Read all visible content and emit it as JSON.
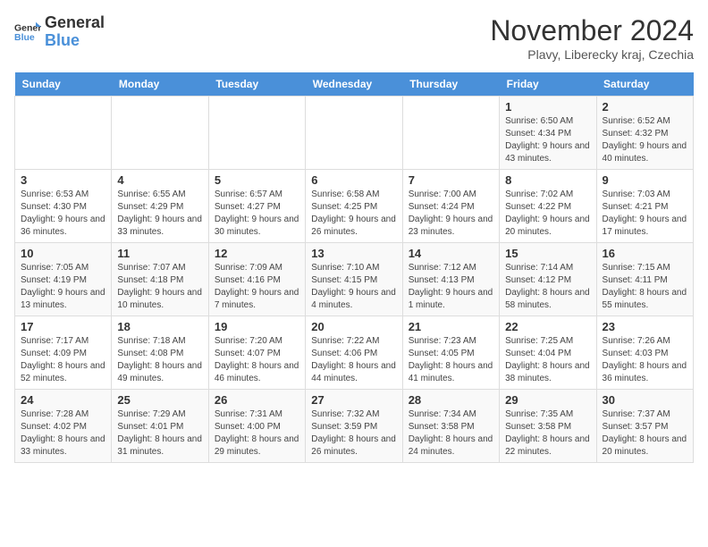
{
  "header": {
    "logo_line1": "General",
    "logo_line2": "Blue",
    "month_title": "November 2024",
    "location": "Plavy, Liberecky kraj, Czechia"
  },
  "weekdays": [
    "Sunday",
    "Monday",
    "Tuesday",
    "Wednesday",
    "Thursday",
    "Friday",
    "Saturday"
  ],
  "weeks": [
    [
      {
        "day": "",
        "info": ""
      },
      {
        "day": "",
        "info": ""
      },
      {
        "day": "",
        "info": ""
      },
      {
        "day": "",
        "info": ""
      },
      {
        "day": "",
        "info": ""
      },
      {
        "day": "1",
        "info": "Sunrise: 6:50 AM\nSunset: 4:34 PM\nDaylight: 9 hours and 43 minutes."
      },
      {
        "day": "2",
        "info": "Sunrise: 6:52 AM\nSunset: 4:32 PM\nDaylight: 9 hours and 40 minutes."
      }
    ],
    [
      {
        "day": "3",
        "info": "Sunrise: 6:53 AM\nSunset: 4:30 PM\nDaylight: 9 hours and 36 minutes."
      },
      {
        "day": "4",
        "info": "Sunrise: 6:55 AM\nSunset: 4:29 PM\nDaylight: 9 hours and 33 minutes."
      },
      {
        "day": "5",
        "info": "Sunrise: 6:57 AM\nSunset: 4:27 PM\nDaylight: 9 hours and 30 minutes."
      },
      {
        "day": "6",
        "info": "Sunrise: 6:58 AM\nSunset: 4:25 PM\nDaylight: 9 hours and 26 minutes."
      },
      {
        "day": "7",
        "info": "Sunrise: 7:00 AM\nSunset: 4:24 PM\nDaylight: 9 hours and 23 minutes."
      },
      {
        "day": "8",
        "info": "Sunrise: 7:02 AM\nSunset: 4:22 PM\nDaylight: 9 hours and 20 minutes."
      },
      {
        "day": "9",
        "info": "Sunrise: 7:03 AM\nSunset: 4:21 PM\nDaylight: 9 hours and 17 minutes."
      }
    ],
    [
      {
        "day": "10",
        "info": "Sunrise: 7:05 AM\nSunset: 4:19 PM\nDaylight: 9 hours and 13 minutes."
      },
      {
        "day": "11",
        "info": "Sunrise: 7:07 AM\nSunset: 4:18 PM\nDaylight: 9 hours and 10 minutes."
      },
      {
        "day": "12",
        "info": "Sunrise: 7:09 AM\nSunset: 4:16 PM\nDaylight: 9 hours and 7 minutes."
      },
      {
        "day": "13",
        "info": "Sunrise: 7:10 AM\nSunset: 4:15 PM\nDaylight: 9 hours and 4 minutes."
      },
      {
        "day": "14",
        "info": "Sunrise: 7:12 AM\nSunset: 4:13 PM\nDaylight: 9 hours and 1 minute."
      },
      {
        "day": "15",
        "info": "Sunrise: 7:14 AM\nSunset: 4:12 PM\nDaylight: 8 hours and 58 minutes."
      },
      {
        "day": "16",
        "info": "Sunrise: 7:15 AM\nSunset: 4:11 PM\nDaylight: 8 hours and 55 minutes."
      }
    ],
    [
      {
        "day": "17",
        "info": "Sunrise: 7:17 AM\nSunset: 4:09 PM\nDaylight: 8 hours and 52 minutes."
      },
      {
        "day": "18",
        "info": "Sunrise: 7:18 AM\nSunset: 4:08 PM\nDaylight: 8 hours and 49 minutes."
      },
      {
        "day": "19",
        "info": "Sunrise: 7:20 AM\nSunset: 4:07 PM\nDaylight: 8 hours and 46 minutes."
      },
      {
        "day": "20",
        "info": "Sunrise: 7:22 AM\nSunset: 4:06 PM\nDaylight: 8 hours and 44 minutes."
      },
      {
        "day": "21",
        "info": "Sunrise: 7:23 AM\nSunset: 4:05 PM\nDaylight: 8 hours and 41 minutes."
      },
      {
        "day": "22",
        "info": "Sunrise: 7:25 AM\nSunset: 4:04 PM\nDaylight: 8 hours and 38 minutes."
      },
      {
        "day": "23",
        "info": "Sunrise: 7:26 AM\nSunset: 4:03 PM\nDaylight: 8 hours and 36 minutes."
      }
    ],
    [
      {
        "day": "24",
        "info": "Sunrise: 7:28 AM\nSunset: 4:02 PM\nDaylight: 8 hours and 33 minutes."
      },
      {
        "day": "25",
        "info": "Sunrise: 7:29 AM\nSunset: 4:01 PM\nDaylight: 8 hours and 31 minutes."
      },
      {
        "day": "26",
        "info": "Sunrise: 7:31 AM\nSunset: 4:00 PM\nDaylight: 8 hours and 29 minutes."
      },
      {
        "day": "27",
        "info": "Sunrise: 7:32 AM\nSunset: 3:59 PM\nDaylight: 8 hours and 26 minutes."
      },
      {
        "day": "28",
        "info": "Sunrise: 7:34 AM\nSunset: 3:58 PM\nDaylight: 8 hours and 24 minutes."
      },
      {
        "day": "29",
        "info": "Sunrise: 7:35 AM\nSunset: 3:58 PM\nDaylight: 8 hours and 22 minutes."
      },
      {
        "day": "30",
        "info": "Sunrise: 7:37 AM\nSunset: 3:57 PM\nDaylight: 8 hours and 20 minutes."
      }
    ]
  ]
}
